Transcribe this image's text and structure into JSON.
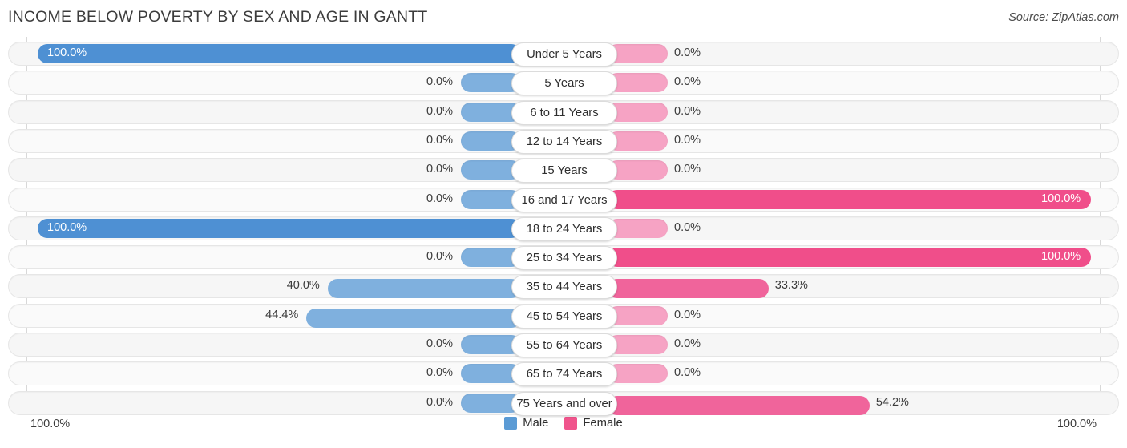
{
  "header": {
    "title": "INCOME BELOW POVERTY BY SEX AND AGE IN GANTT",
    "source": "Source: ZipAtlas.com"
  },
  "legend": {
    "male_label": "Male",
    "female_label": "Female",
    "male_color": "#5b9bd5",
    "female_color": "#f0548c"
  },
  "axis": {
    "left_label": "100.0%",
    "right_label": "100.0%",
    "max": 100
  },
  "chart_data": {
    "type": "bar",
    "title": "INCOME BELOW POVERTY BY SEX AND AGE IN GANTT",
    "xlabel": "",
    "ylabel": "",
    "orientation": "horizontal-diverging",
    "xlim": [
      0,
      100
    ],
    "grid": true,
    "legend_position": "bottom-center",
    "categories": [
      "Under 5 Years",
      "5 Years",
      "6 to 11 Years",
      "12 to 14 Years",
      "15 Years",
      "16 and 17 Years",
      "18 to 24 Years",
      "25 to 34 Years",
      "35 to 44 Years",
      "45 to 54 Years",
      "55 to 64 Years",
      "65 to 74 Years",
      "75 Years and over"
    ],
    "series": [
      {
        "name": "Male",
        "color": "#5b9bd5",
        "values": [
          100.0,
          0.0,
          0.0,
          0.0,
          0.0,
          0.0,
          100.0,
          0.0,
          40.0,
          44.4,
          0.0,
          0.0,
          0.0
        ],
        "labels": [
          "100.0%",
          "0.0%",
          "0.0%",
          "0.0%",
          "0.0%",
          "0.0%",
          "100.0%",
          "0.0%",
          "40.0%",
          "44.4%",
          "0.0%",
          "0.0%",
          "0.0%"
        ]
      },
      {
        "name": "Female",
        "color": "#f0548c",
        "values": [
          0.0,
          0.0,
          0.0,
          0.0,
          0.0,
          100.0,
          0.0,
          100.0,
          33.3,
          0.0,
          0.0,
          0.0,
          54.2
        ],
        "labels": [
          "0.0%",
          "0.0%",
          "0.0%",
          "0.0%",
          "0.0%",
          "100.0%",
          "0.0%",
          "100.0%",
          "33.3%",
          "0.0%",
          "0.0%",
          "0.0%",
          "54.2%"
        ]
      }
    ]
  }
}
